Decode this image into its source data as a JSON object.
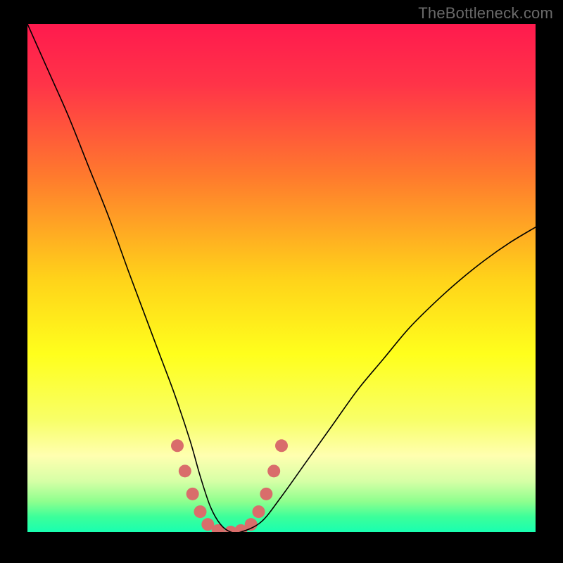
{
  "watermark": "TheBottleneck.com",
  "chart_data": {
    "type": "line",
    "title": "",
    "xlabel": "",
    "ylabel": "",
    "xlim": [
      0,
      100
    ],
    "ylim": [
      0,
      100
    ],
    "grid": false,
    "legend": false,
    "background": {
      "kind": "vertical-gradient",
      "stops": [
        {
          "pct": 0,
          "color": "#ff1a4e"
        },
        {
          "pct": 12,
          "color": "#ff3448"
        },
        {
          "pct": 30,
          "color": "#ff7a2d"
        },
        {
          "pct": 50,
          "color": "#ffd21a"
        },
        {
          "pct": 65,
          "color": "#ffff1c"
        },
        {
          "pct": 78,
          "color": "#f8ff68"
        },
        {
          "pct": 85,
          "color": "#ffffb0"
        },
        {
          "pct": 90,
          "color": "#d6ffa6"
        },
        {
          "pct": 94,
          "color": "#8eff8e"
        },
        {
          "pct": 97,
          "color": "#3cff9a"
        },
        {
          "pct": 100,
          "color": "#19ffb0"
        }
      ]
    },
    "series": [
      {
        "name": "bottleneck-curve",
        "stroke": "#000000",
        "stroke_width": 1.6,
        "x": [
          0,
          4,
          8,
          12,
          16,
          20,
          23,
          26,
          29,
          32,
          34,
          36,
          38,
          40,
          42,
          46,
          50,
          55,
          60,
          65,
          70,
          75,
          80,
          85,
          90,
          95,
          100
        ],
        "y": [
          100,
          91,
          82,
          72,
          62,
          51,
          43,
          35,
          27,
          18,
          11,
          5,
          1.5,
          0,
          0,
          2,
          7,
          14,
          21,
          28,
          34,
          40,
          45,
          49.5,
          53.5,
          57,
          60
        ]
      }
    ],
    "markers": {
      "name": "highlight-pills",
      "color": "#d96d6b",
      "radius": 9,
      "points": [
        {
          "x": 29.5,
          "y": 17.0
        },
        {
          "x": 31.0,
          "y": 12.0
        },
        {
          "x": 32.5,
          "y": 7.5
        },
        {
          "x": 34.0,
          "y": 4.0
        },
        {
          "x": 35.5,
          "y": 1.5
        },
        {
          "x": 37.5,
          "y": 0.3
        },
        {
          "x": 40.0,
          "y": 0.0
        },
        {
          "x": 42.0,
          "y": 0.3
        },
        {
          "x": 44.0,
          "y": 1.5
        },
        {
          "x": 45.5,
          "y": 4.0
        },
        {
          "x": 47.0,
          "y": 7.5
        },
        {
          "x": 48.5,
          "y": 12.0
        },
        {
          "x": 50.0,
          "y": 17.0
        }
      ]
    }
  }
}
